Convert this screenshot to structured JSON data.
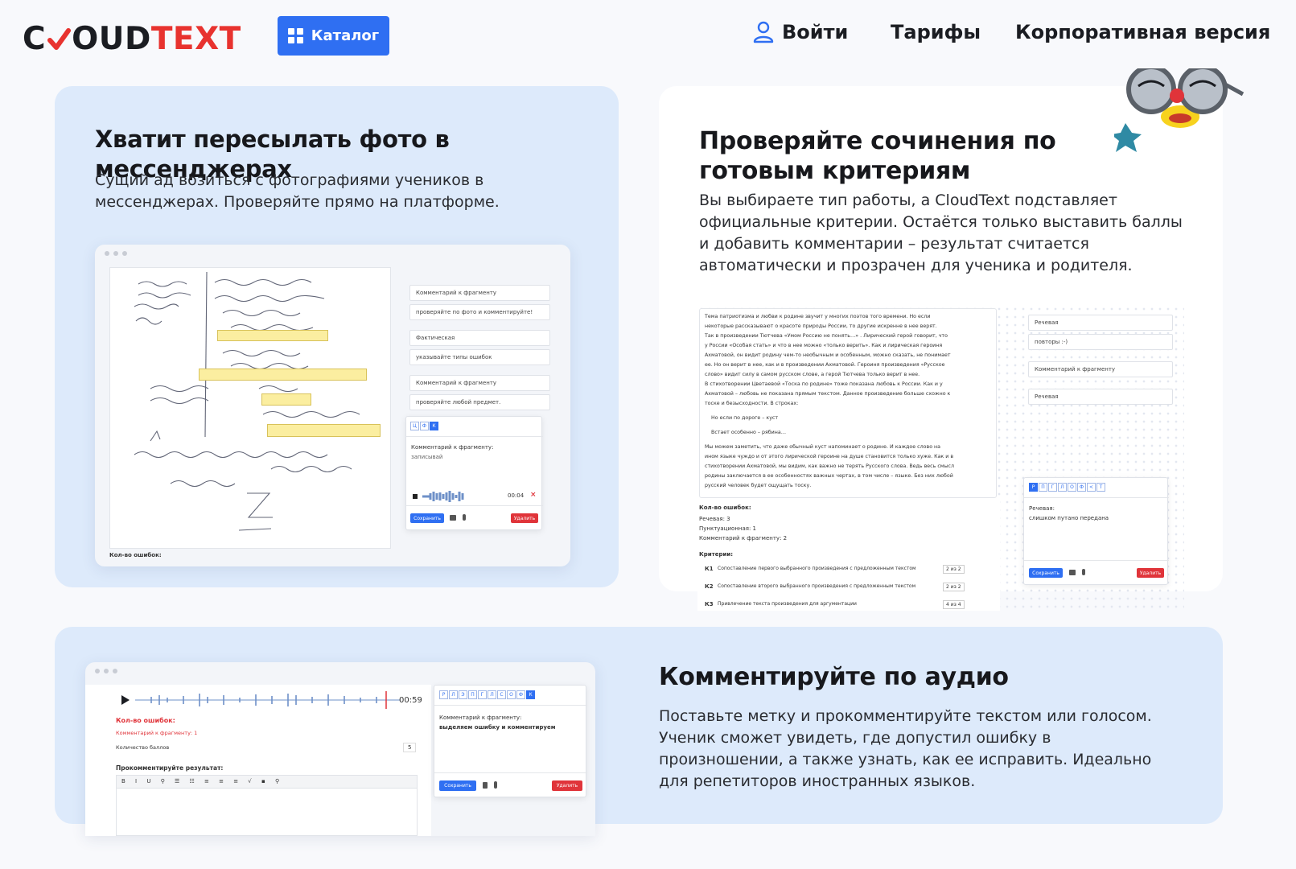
{
  "header": {
    "logo": {
      "part1": "C",
      "part2": "OUD",
      "part3": "TEXT"
    },
    "catalog_label": "Каталог",
    "nav": {
      "login": "Войти",
      "tariffs": "Тарифы",
      "corporate": "Корпоративная версия"
    }
  },
  "colors": {
    "accent": "#2f6ff2",
    "brand_red": "#e8332f",
    "card_blue": "#ddeafb",
    "highlight": "#fbeea0"
  },
  "card1": {
    "title": "Хватит пересылать фото в мессенджерах",
    "text": "Сущий ад возиться с фотографиями учеников в мессенджерах. Проверяйте прямо на платформе.",
    "mock": {
      "fields": [
        {
          "label": "Комментарий к фрагменту",
          "value": "проверяйте по фото и комментируйте!"
        },
        {
          "label": "Фактическая",
          "value": "указывайте типы ошибок"
        },
        {
          "label": "Комментарий к фрагменту",
          "value": "проверяйте любой предмет."
        }
      ],
      "letters": [
        "Ц",
        "Ф",
        "К"
      ],
      "popup_label": "Комментарий к фрагменту:",
      "popup_value": "записывай",
      "audio_time": "00:04",
      "save": "Сохранить",
      "delete": "Удалить",
      "errors_label": "Кол-во ошибок:"
    }
  },
  "card2": {
    "title": "Проверяйте сочинения по готовым критериям",
    "text": "Вы выбираете тип работы, а CloudText подставляет официальные критерии. Остаётся только выставить баллы и добавить комментарии – результат считается автоматически и прозрачен для ученика и родителя.",
    "mock": {
      "essay": [
        "Тема патриотизма и любви к родине звучит у многих поэтов того времени. Но если",
        "некоторые рассказывают о красоте природы России, то другие искренне в нее верят.",
        "Так в произведении Тютчева «Умом Россию не понять…» . Лирический герой говорит, что",
        "у России «Особая стать» и что в нее можно «только верить». Как и лирическая героиня",
        "Ахматовой, он видит родину чем-то необычным и особенным, можно сказать, не понимает",
        "ее. Но он верит в нее, как и в произведении Ахматовой. Героиня произведения «Русское",
        "слово» видит силу в самом русском слове, а герой Тютчева только верит в нее.",
        "В стихотворении Цветаевой «Тоска по родине» тоже показана любовь к России. Как и у",
        "Ахматовой – любовь не показана прямым текстом. Данное произведение больше схожно к",
        "тоске и безысходности. В строках:"
      ],
      "quote1": "Но если по дороге – куст",
      "quote2": "Встает особенно – рябина…",
      "essay2": [
        "Мы можем заметить, что даже обычный куст напоминает о родине. И каждое слово на",
        "ином языке чуждо и от этого лирической героине на душе становится только хуже. Как и в",
        "стихотворении Ахматовой, мы видим, как важно не терять Русского слова. Ведь весь смысл",
        "родины заключается в ее особенностях важных чертах, в том числе – языке. Без них любой",
        "русский человек будет ощущать тоску."
      ],
      "errors_label": "Кол-во ошибок:",
      "errors": [
        "Речевая: 3",
        "Пунктуационная: 1",
        "Комментарий к фрагменту: 2"
      ],
      "criteria_label": "Критерии:",
      "criteria": [
        {
          "code": "К1",
          "text": "Сопоставление первого выбранного произведения с предложенным текстом",
          "score": "2 из 2"
        },
        {
          "code": "К2",
          "text": "Сопоставление второго выбранного произведения с предложенным текстом",
          "score": "2 из 2"
        },
        {
          "code": "К3",
          "text": "Привлечение текста произведения для аргументации",
          "score": "4 из 4"
        }
      ],
      "side_fields": [
        "Речевая",
        "повторы :-)",
        "Комментарий к фрагменту",
        "Речевая"
      ],
      "letters": [
        "Р",
        "П",
        "Г",
        "Л",
        "О",
        "Ф",
        "<",
        "Т"
      ],
      "popup_label": "Речевая:",
      "popup_value": "слишком путано передана",
      "save": "Сохранить",
      "delete": "Удалить"
    }
  },
  "card3": {
    "title": "Комментируйте по аудио",
    "text": "Поставьте метку и прокомментируйте текстом или голосом. Ученик сможет увидеть, где допустил ошибку в произношении, а также узнать, как ее исправить. Идеально для репетиторов иностранных языков.",
    "mock": {
      "audio_time": "00:59",
      "errors_label": "Кол-во ошибок:",
      "fragment_comment": "Комментарий к фрагменту: 1",
      "score_label": "Количество баллов",
      "score_value": "5",
      "result_label": "Прокомментируйте результат:",
      "letters": [
        "Р",
        "Л",
        "Э",
        "П",
        "Г",
        "Л",
        "С",
        "О",
        "Ф",
        "К"
      ],
      "popup_label": "Комментарий к фрагменту:",
      "popup_value": "выделяем ошибку и комментируем",
      "save": "Сохранить",
      "delete": "Удалить"
    }
  }
}
